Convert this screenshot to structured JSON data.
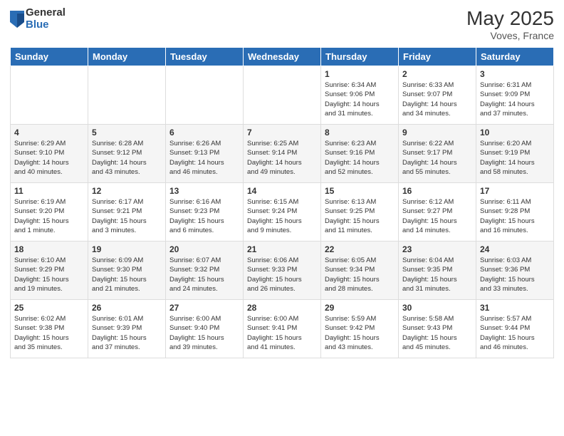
{
  "logo": {
    "general": "General",
    "blue": "Blue"
  },
  "title": "May 2025",
  "location": "Voves, France",
  "days_of_week": [
    "Sunday",
    "Monday",
    "Tuesday",
    "Wednesday",
    "Thursday",
    "Friday",
    "Saturday"
  ],
  "weeks": [
    [
      {
        "day": "",
        "info": ""
      },
      {
        "day": "",
        "info": ""
      },
      {
        "day": "",
        "info": ""
      },
      {
        "day": "",
        "info": ""
      },
      {
        "day": "1",
        "info": "Sunrise: 6:34 AM\nSunset: 9:06 PM\nDaylight: 14 hours\nand 31 minutes."
      },
      {
        "day": "2",
        "info": "Sunrise: 6:33 AM\nSunset: 9:07 PM\nDaylight: 14 hours\nand 34 minutes."
      },
      {
        "day": "3",
        "info": "Sunrise: 6:31 AM\nSunset: 9:09 PM\nDaylight: 14 hours\nand 37 minutes."
      }
    ],
    [
      {
        "day": "4",
        "info": "Sunrise: 6:29 AM\nSunset: 9:10 PM\nDaylight: 14 hours\nand 40 minutes."
      },
      {
        "day": "5",
        "info": "Sunrise: 6:28 AM\nSunset: 9:12 PM\nDaylight: 14 hours\nand 43 minutes."
      },
      {
        "day": "6",
        "info": "Sunrise: 6:26 AM\nSunset: 9:13 PM\nDaylight: 14 hours\nand 46 minutes."
      },
      {
        "day": "7",
        "info": "Sunrise: 6:25 AM\nSunset: 9:14 PM\nDaylight: 14 hours\nand 49 minutes."
      },
      {
        "day": "8",
        "info": "Sunrise: 6:23 AM\nSunset: 9:16 PM\nDaylight: 14 hours\nand 52 minutes."
      },
      {
        "day": "9",
        "info": "Sunrise: 6:22 AM\nSunset: 9:17 PM\nDaylight: 14 hours\nand 55 minutes."
      },
      {
        "day": "10",
        "info": "Sunrise: 6:20 AM\nSunset: 9:19 PM\nDaylight: 14 hours\nand 58 minutes."
      }
    ],
    [
      {
        "day": "11",
        "info": "Sunrise: 6:19 AM\nSunset: 9:20 PM\nDaylight: 15 hours\nand 1 minute."
      },
      {
        "day": "12",
        "info": "Sunrise: 6:17 AM\nSunset: 9:21 PM\nDaylight: 15 hours\nand 3 minutes."
      },
      {
        "day": "13",
        "info": "Sunrise: 6:16 AM\nSunset: 9:23 PM\nDaylight: 15 hours\nand 6 minutes."
      },
      {
        "day": "14",
        "info": "Sunrise: 6:15 AM\nSunset: 9:24 PM\nDaylight: 15 hours\nand 9 minutes."
      },
      {
        "day": "15",
        "info": "Sunrise: 6:13 AM\nSunset: 9:25 PM\nDaylight: 15 hours\nand 11 minutes."
      },
      {
        "day": "16",
        "info": "Sunrise: 6:12 AM\nSunset: 9:27 PM\nDaylight: 15 hours\nand 14 minutes."
      },
      {
        "day": "17",
        "info": "Sunrise: 6:11 AM\nSunset: 9:28 PM\nDaylight: 15 hours\nand 16 minutes."
      }
    ],
    [
      {
        "day": "18",
        "info": "Sunrise: 6:10 AM\nSunset: 9:29 PM\nDaylight: 15 hours\nand 19 minutes."
      },
      {
        "day": "19",
        "info": "Sunrise: 6:09 AM\nSunset: 9:30 PM\nDaylight: 15 hours\nand 21 minutes."
      },
      {
        "day": "20",
        "info": "Sunrise: 6:07 AM\nSunset: 9:32 PM\nDaylight: 15 hours\nand 24 minutes."
      },
      {
        "day": "21",
        "info": "Sunrise: 6:06 AM\nSunset: 9:33 PM\nDaylight: 15 hours\nand 26 minutes."
      },
      {
        "day": "22",
        "info": "Sunrise: 6:05 AM\nSunset: 9:34 PM\nDaylight: 15 hours\nand 28 minutes."
      },
      {
        "day": "23",
        "info": "Sunrise: 6:04 AM\nSunset: 9:35 PM\nDaylight: 15 hours\nand 31 minutes."
      },
      {
        "day": "24",
        "info": "Sunrise: 6:03 AM\nSunset: 9:36 PM\nDaylight: 15 hours\nand 33 minutes."
      }
    ],
    [
      {
        "day": "25",
        "info": "Sunrise: 6:02 AM\nSunset: 9:38 PM\nDaylight: 15 hours\nand 35 minutes."
      },
      {
        "day": "26",
        "info": "Sunrise: 6:01 AM\nSunset: 9:39 PM\nDaylight: 15 hours\nand 37 minutes."
      },
      {
        "day": "27",
        "info": "Sunrise: 6:00 AM\nSunset: 9:40 PM\nDaylight: 15 hours\nand 39 minutes."
      },
      {
        "day": "28",
        "info": "Sunrise: 6:00 AM\nSunset: 9:41 PM\nDaylight: 15 hours\nand 41 minutes."
      },
      {
        "day": "29",
        "info": "Sunrise: 5:59 AM\nSunset: 9:42 PM\nDaylight: 15 hours\nand 43 minutes."
      },
      {
        "day": "30",
        "info": "Sunrise: 5:58 AM\nSunset: 9:43 PM\nDaylight: 15 hours\nand 45 minutes."
      },
      {
        "day": "31",
        "info": "Sunrise: 5:57 AM\nSunset: 9:44 PM\nDaylight: 15 hours\nand 46 minutes."
      }
    ]
  ]
}
